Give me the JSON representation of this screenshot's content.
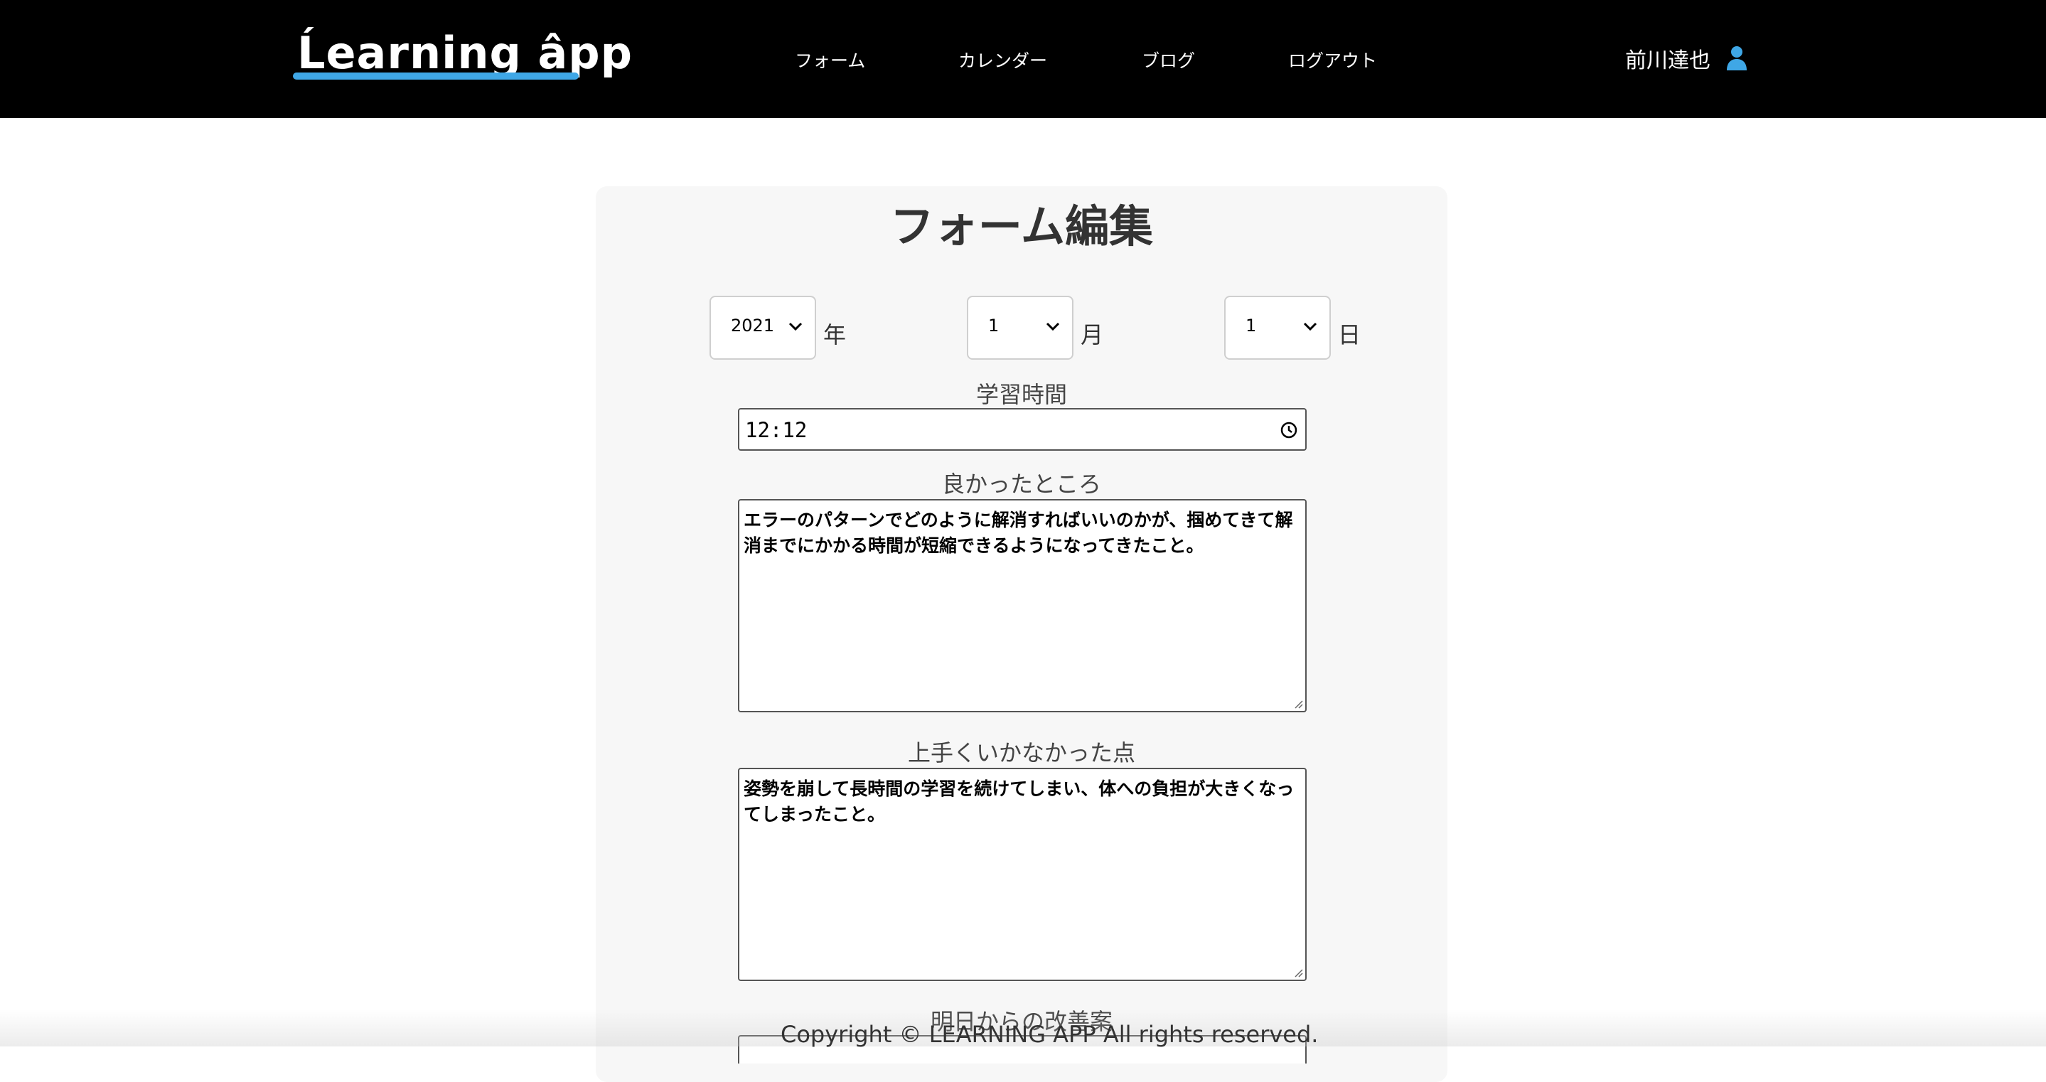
{
  "header": {
    "logo": "Ĺearning âpp",
    "nav": [
      "フォーム",
      "カレンダー",
      "ブログ",
      "ログアウト"
    ],
    "user_name": "前川達也",
    "user_icon": "user-icon"
  },
  "form": {
    "title": "フォーム編集",
    "year": {
      "value": "2021",
      "unit": "年"
    },
    "month": {
      "value": "1",
      "unit": "月"
    },
    "day": {
      "value": "1",
      "unit": "日"
    },
    "study_time": {
      "label": "学習時間",
      "value": "12:12"
    },
    "good_points": {
      "label": "良かったところ",
      "value": "エラーのパターンでどのように解消すればいいのかが、掴めてきて解消までにかかる時間が短縮できるようになってきたこと。"
    },
    "bad_points": {
      "label": "上手くいかなかった点",
      "value": "姿勢を崩して長時間の学習を続けてしまい、体への負担が大きくなってしまったこと。"
    },
    "improvement": {
      "label": "明日からの改善案"
    }
  },
  "footer": {
    "copyright": "Copyright © LEARNING APP All rights reserved."
  },
  "colors": {
    "header_bg": "#000000",
    "accent": "#3fa7e6",
    "card_bg": "#f7f7f7"
  }
}
